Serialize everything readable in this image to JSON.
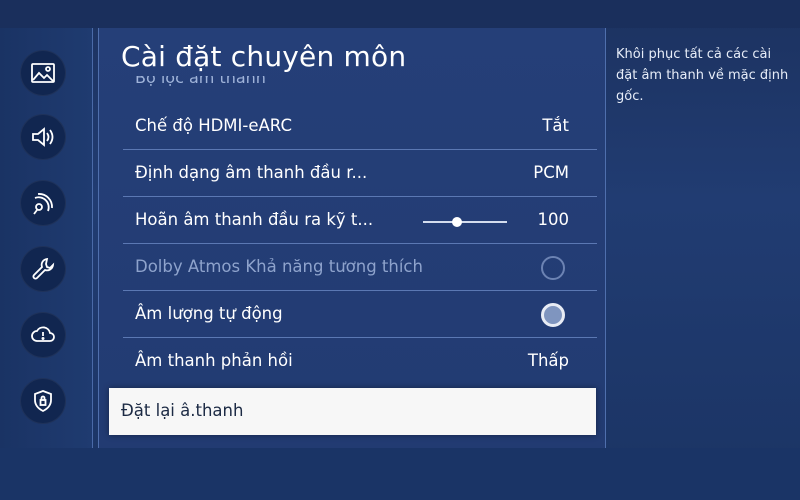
{
  "panel": {
    "title": "Cài đặt chuyên môn",
    "partial_item": "Bộ lọc âm thanh"
  },
  "menu": [
    {
      "label": "Chế độ HDMI-eARC",
      "value": "Tắt"
    },
    {
      "label": "Định dạng âm thanh đầu r...",
      "value": "PCM"
    },
    {
      "label": "Hoãn âm thanh đầu ra kỹ t...",
      "value": "100",
      "slider_fraction": 0.4
    },
    {
      "label": "Dolby Atmos Khả năng tương thích",
      "state": "disabled"
    },
    {
      "label": "Âm lượng tự động",
      "state": "enabled"
    },
    {
      "label": "Âm thanh phản hồi",
      "value": "Thấp"
    }
  ],
  "selected": {
    "label": "Đặt lại â.thanh"
  },
  "help": {
    "text": "Khôi phục tất cả các cài đặt âm thanh về mặc định gốc."
  },
  "sidebar_icons": [
    "picture-icon",
    "sound-icon",
    "broadcasting-icon",
    "wrench-icon",
    "cloud-support-icon",
    "shield-icon"
  ],
  "colors": {
    "background": "#213c72",
    "selection": "#f7f7f7",
    "text": "#ffffff",
    "disabled_text": "#8ea3cc"
  }
}
